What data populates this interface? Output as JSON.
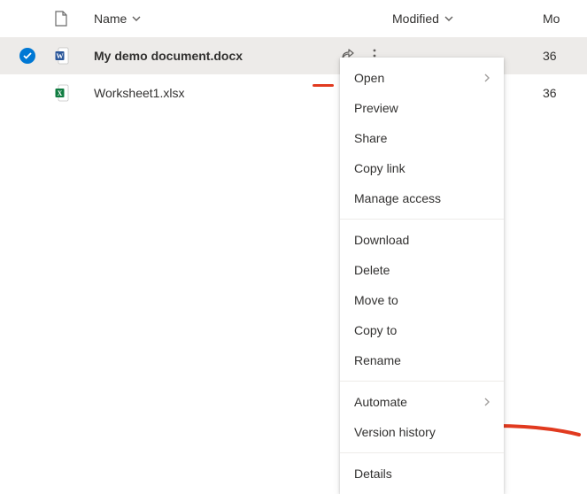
{
  "headers": {
    "name": "Name",
    "modified": "Modified",
    "modified_by": "Mo"
  },
  "rows": [
    {
      "name": "My demo document.docx",
      "modified_suffix": "36",
      "selected": true,
      "type": "docx"
    },
    {
      "name": "Worksheet1.xlsx",
      "modified_suffix": "36",
      "selected": false,
      "type": "xlsx"
    }
  ],
  "menu": {
    "open": "Open",
    "preview": "Preview",
    "share": "Share",
    "copy_link": "Copy link",
    "manage_access": "Manage access",
    "download": "Download",
    "delete": "Delete",
    "move_to": "Move to",
    "copy_to": "Copy to",
    "rename": "Rename",
    "automate": "Automate",
    "version_history": "Version history",
    "details": "Details"
  }
}
